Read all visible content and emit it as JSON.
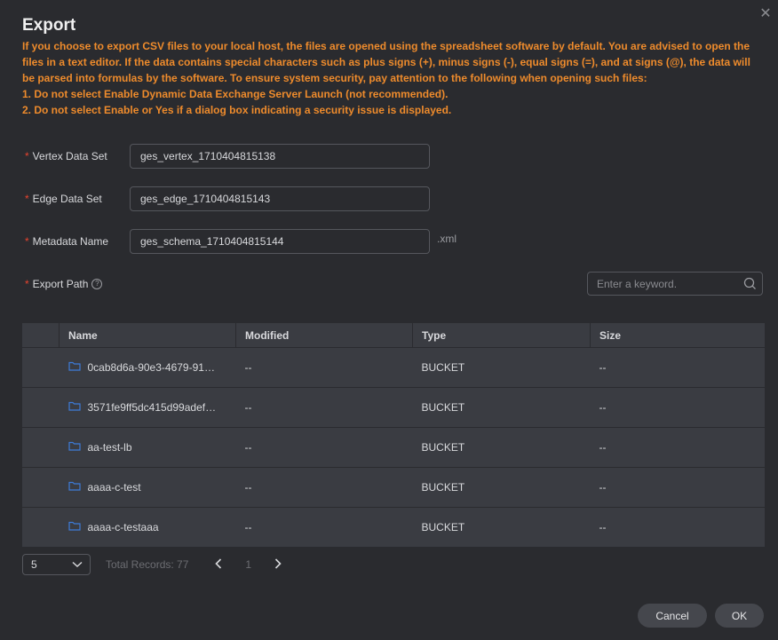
{
  "dialog": {
    "title": "Export",
    "close_icon": "close-icon"
  },
  "notice": {
    "paragraph": "If you choose to export CSV files to your local host, the files are opened using the spreadsheet software by default. You are advised to open the files in a text editor. If the data contains special characters such as plus signs (+), minus signs (-), equal signs (=), and at signs (@), the data will be parsed into formulas by the software. To ensure system security, pay attention to the following when opening such files:",
    "item1": "1. Do not select Enable Dynamic Data Exchange Server Launch (not recommended).",
    "item2": "2. Do not select Enable or Yes if a dialog box indicating a security issue is displayed.",
    "color": "#ee8b2c"
  },
  "form": {
    "required_mark": "*",
    "vertex_label": "Vertex Data Set",
    "vertex_value": "ges_vertex_1710404815138",
    "edge_label": "Edge Data Set",
    "edge_value": "ges_edge_1710404815143",
    "metadata_label": "Metadata Name",
    "metadata_value": "ges_schema_1710404815144",
    "metadata_suffix": ".xml",
    "path_label": "Export Path",
    "help_glyph": "?"
  },
  "search": {
    "placeholder": "Enter a keyword."
  },
  "table": {
    "columns": [
      "Name",
      "Modified",
      "Type",
      "Size"
    ],
    "rows": [
      {
        "name": "0cab8d6a-90e3-4679-915…",
        "modified": "--",
        "type": "BUCKET",
        "size": "--"
      },
      {
        "name": "3571fe9ff5dc415d99adef8…",
        "modified": "--",
        "type": "BUCKET",
        "size": "--"
      },
      {
        "name": "aa-test-lb",
        "modified": "--",
        "type": "BUCKET",
        "size": "--"
      },
      {
        "name": "aaaa-c-test",
        "modified": "--",
        "type": "BUCKET",
        "size": "--"
      },
      {
        "name": "aaaa-c-testaaa",
        "modified": "--",
        "type": "BUCKET",
        "size": "--"
      }
    ],
    "folder_color": "#3d7bd9"
  },
  "pager": {
    "page_size": "5",
    "total": "Total Records: 77",
    "current_page": "1"
  },
  "buttons": {
    "cancel": "Cancel",
    "ok": "OK"
  }
}
